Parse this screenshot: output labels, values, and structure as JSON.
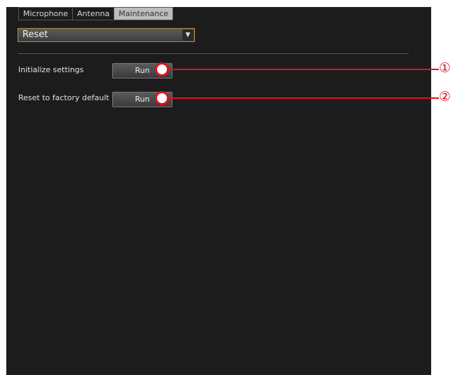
{
  "tabs": [
    "Microphone",
    "Antenna",
    "Maintenance"
  ],
  "active_tab": "Maintenance",
  "dropdown": {
    "value": "Reset",
    "arrow": "▼"
  },
  "settings": [
    {
      "label": "Initialize settings",
      "button": "Run",
      "marker": "①"
    },
    {
      "label": "Reset to factory default",
      "button": "Run",
      "marker": "②"
    }
  ],
  "colors": {
    "panel": "#1c1c1c",
    "callout": "#e01020",
    "dropdown_border": "#b48a3c"
  }
}
